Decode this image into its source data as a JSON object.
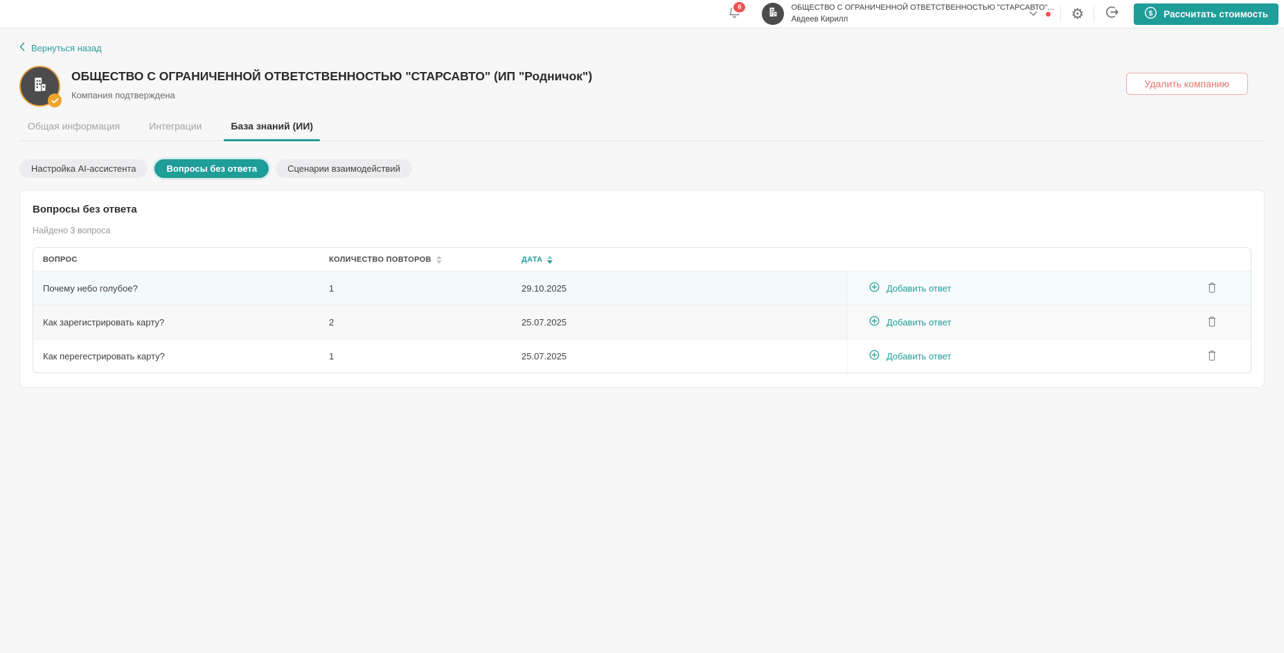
{
  "colors": {
    "accent": "#1F9D99",
    "accent_light": "#8FD2CF",
    "danger": "#EF706D",
    "badge_red": "#F05252",
    "verified_orange": "#F0A42C",
    "avatar_bg": "#4C4C4C",
    "avatar_ring": "#E8A33D"
  },
  "icons": {
    "bell-icon": "svg-bell-outline",
    "building-icon": "svg-building",
    "chevron-down-icon": "svg-chevron-down",
    "chevron-left-icon": "svg-chevron-left",
    "gear-icon": "⚙",
    "logout-icon": "svg-circle-arrow-right",
    "dollar-circle-icon": "($)",
    "verified-badge-icon": "✓",
    "plus-circle-icon": "(+)",
    "trash-icon": "svg-trash-outline",
    "sort-icon": "▲▼"
  },
  "topbar": {
    "notification_count": "6",
    "account": {
      "company_name": "ОБЩЕСТВО С ОГРАНИЧЕННОЙ ОТВЕТСТВЕННОСТЬЮ \"СТАРСАВТО\"...",
      "user_name": "Авдеев Кирилл"
    },
    "calculate_button_label": "Рассчитать стоимость"
  },
  "page": {
    "back_link_label": "Вернуться назад",
    "company_title": "ОБЩЕСТВО С ОГРАНИЧЕННОЙ ОТВЕТСТВЕННОСТЬЮ \"СТАРСАВТО\" (ИП \"Родничок\")",
    "company_status": "Компания подтверждена",
    "delete_company_label": "Удалить компанию",
    "tabs": [
      {
        "label": "Общая информация",
        "active": false
      },
      {
        "label": "Интеграции",
        "active": false
      },
      {
        "label": "База знаний (ИИ)",
        "active": true
      }
    ],
    "subtabs": [
      {
        "label": "Настройка AI-ассистента",
        "active": false
      },
      {
        "label": "Вопросы без ответа",
        "active": true
      },
      {
        "label": "Сценарии взаимодействий",
        "active": false
      }
    ]
  },
  "panel": {
    "title": "Вопросы без ответа",
    "result_count_text": "Найдено 3 вопроса",
    "table": {
      "columns": [
        {
          "label": "ВОПРОС",
          "sortable": false,
          "sorted": false
        },
        {
          "label": "КОЛИЧЕСТВО ПОВТОРОВ",
          "sortable": true,
          "sorted": false
        },
        {
          "label": "ДАТА",
          "sortable": true,
          "sorted": "desc"
        }
      ],
      "row_action_label": "Добавить ответ",
      "rows": [
        {
          "question": "Почему небо голубое?",
          "repeat_count": "1",
          "date": "29.10.2025"
        },
        {
          "question": "Как зарегистрировать карту?",
          "repeat_count": "2",
          "date": "25.07.2025"
        },
        {
          "question": "Как перегестрировать карту?",
          "repeat_count": "1",
          "date": "25.07.2025"
        }
      ]
    }
  }
}
